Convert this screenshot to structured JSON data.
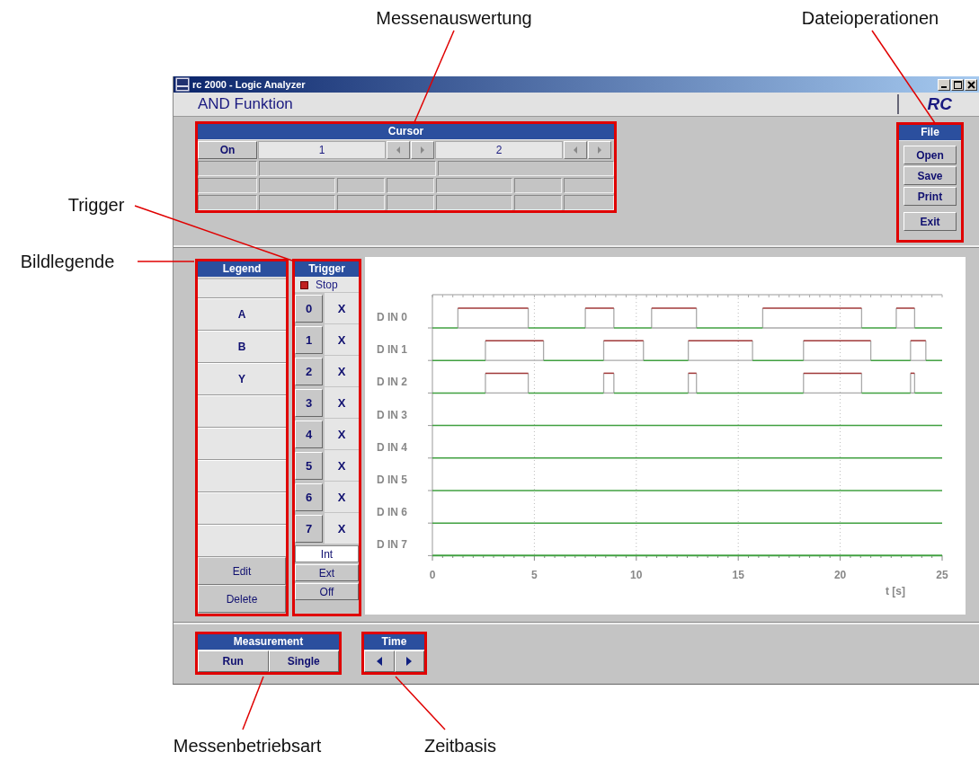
{
  "callouts": [
    {
      "label": "Messenauswertung"
    },
    {
      "label": "Dateioperationen"
    },
    {
      "label": "Trigger"
    },
    {
      "label": "Bildlegende"
    },
    {
      "label": "Messenbetriebsart"
    },
    {
      "label": "Zeitbasis"
    }
  ],
  "window": {
    "title": "rc 2000 - Logic Analyzer"
  },
  "header": {
    "title": "AND Funktion",
    "logo": "RC"
  },
  "cursor": {
    "title": "Cursor",
    "toggle": "On",
    "cursors": [
      {
        "label": "1"
      },
      {
        "label": "2"
      }
    ]
  },
  "file": {
    "title": "File",
    "buttons": [
      "Open",
      "Save",
      "Print",
      "Exit"
    ]
  },
  "legend": {
    "title": "Legend",
    "entries": [
      "A",
      "B",
      "Y"
    ],
    "buttons": [
      "Edit",
      "Delete"
    ]
  },
  "trigger": {
    "title": "Trigger",
    "status": "Stop",
    "running": false,
    "channels": [
      {
        "label": "0",
        "mark": "X"
      },
      {
        "label": "1",
        "mark": "X"
      },
      {
        "label": "2",
        "mark": "X"
      },
      {
        "label": "3",
        "mark": "X"
      },
      {
        "label": "4",
        "mark": "X"
      },
      {
        "label": "5",
        "mark": "X"
      },
      {
        "label": "6",
        "mark": "X"
      },
      {
        "label": "7",
        "mark": "X"
      }
    ],
    "modes": [
      {
        "label": "Int",
        "selected": true
      },
      {
        "label": "Ext",
        "selected": false
      },
      {
        "label": "Off",
        "selected": false
      }
    ]
  },
  "timing": {
    "channels": [
      "D IN 0",
      "D IN 1",
      "D IN 2",
      "D IN 3",
      "D IN 4",
      "D IN 5",
      "D IN 6",
      "D IN 7"
    ],
    "ticks": [
      "0",
      "5",
      "10",
      "15",
      "20",
      "25"
    ],
    "axis_label": "t [s]"
  },
  "measurement": {
    "title": "Measurement",
    "buttons": [
      "Run",
      "Single"
    ]
  },
  "time": {
    "title": "Time"
  }
}
